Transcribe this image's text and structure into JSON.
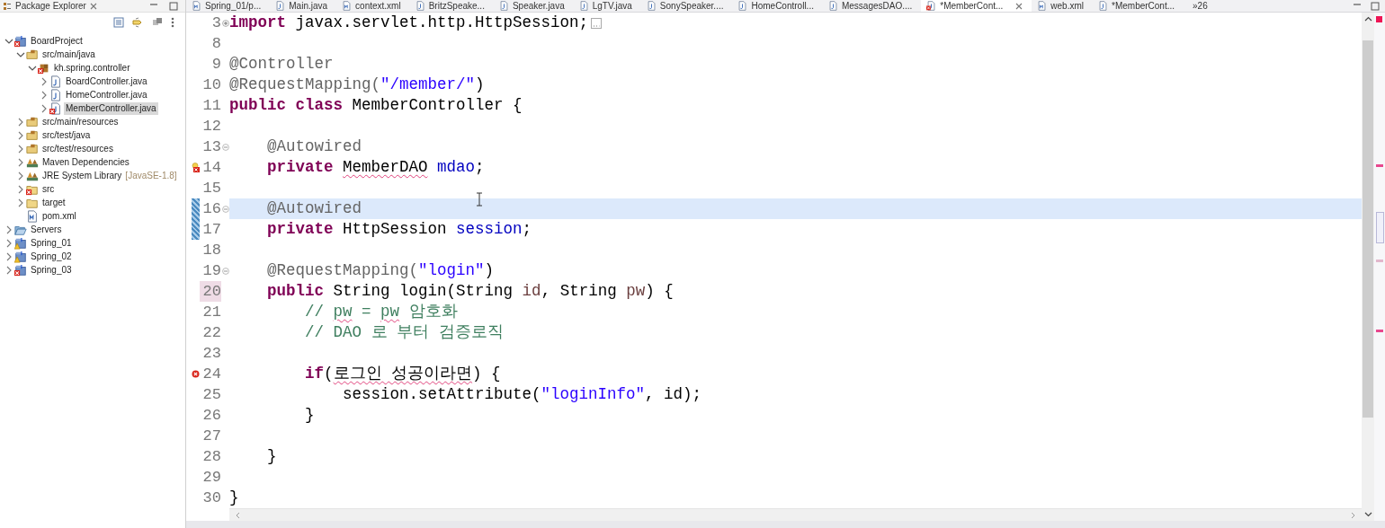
{
  "explorer": {
    "title": "Package Explorer",
    "tree": [
      {
        "label": "BoardProject",
        "kind": "project",
        "error": true,
        "expanded": true,
        "selected": false,
        "children": [
          {
            "label": "src/main/java",
            "kind": "source-folder",
            "expanded": true,
            "selected": false,
            "children": [
              {
                "label": "kh.spring.controller",
                "kind": "package",
                "error": true,
                "expanded": true,
                "selected": false,
                "children": [
                  {
                    "label": "BoardController.java",
                    "kind": "java-file",
                    "expanded": false,
                    "selected": false
                  },
                  {
                    "label": "HomeController.java",
                    "kind": "java-file",
                    "expanded": false,
                    "selected": false
                  },
                  {
                    "label": "MemberController.java",
                    "kind": "java-file",
                    "error": true,
                    "expanded": false,
                    "selected": true
                  }
                ]
              }
            ]
          },
          {
            "label": "src/main/resources",
            "kind": "source-folder",
            "expanded": false,
            "selected": false
          },
          {
            "label": "src/test/java",
            "kind": "source-folder",
            "expanded": false,
            "selected": false
          },
          {
            "label": "src/test/resources",
            "kind": "source-folder",
            "expanded": false,
            "selected": false
          },
          {
            "label": "Maven Dependencies",
            "kind": "library",
            "expanded": false,
            "selected": false
          },
          {
            "label": "JRE System Library",
            "decoration": "[JavaSE-1.8]",
            "kind": "library",
            "expanded": false,
            "selected": false
          },
          {
            "label": "src",
            "kind": "folder",
            "error": true,
            "expanded": false,
            "selected": false
          },
          {
            "label": "target",
            "kind": "folder",
            "expanded": false,
            "selected": false
          },
          {
            "label": "pom.xml",
            "kind": "xml-file",
            "selected": false
          }
        ]
      },
      {
        "label": "Servers",
        "kind": "open-folder",
        "expanded": false,
        "selected": false
      },
      {
        "label": "Spring_01",
        "kind": "project",
        "warning": true,
        "expanded": false,
        "selected": false
      },
      {
        "label": "Spring_02",
        "kind": "project",
        "warning": true,
        "expanded": false,
        "selected": false
      },
      {
        "label": "Spring_03",
        "kind": "project",
        "error": true,
        "expanded": false,
        "selected": false
      }
    ]
  },
  "tabs": [
    {
      "label": "Spring_01/p...",
      "kind": "xml-file",
      "selected": false
    },
    {
      "label": "Main.java",
      "kind": "java-file",
      "selected": false
    },
    {
      "label": "context.xml",
      "kind": "xml-file",
      "selected": false
    },
    {
      "label": "BritzSpeake...",
      "kind": "java-file",
      "selected": false
    },
    {
      "label": "Speaker.java",
      "kind": "java-file",
      "selected": false
    },
    {
      "label": "LgTV.java",
      "kind": "java-file",
      "selected": false
    },
    {
      "label": "SonySpeaker....",
      "kind": "java-file",
      "selected": false
    },
    {
      "label": "HomeControll...",
      "kind": "java-file",
      "selected": false
    },
    {
      "label": "MessagesDAO....",
      "kind": "java-file",
      "selected": false
    },
    {
      "label": "*MemberCont...",
      "kind": "java-file",
      "error": true,
      "selected": true
    },
    {
      "label": "web.xml",
      "kind": "xml-file",
      "selected": false
    },
    {
      "label": "*MemberCont...",
      "kind": "java-file",
      "selected": false
    }
  ],
  "more_tabs": "»26",
  "lines": [
    {
      "number": "3",
      "collapsed": true,
      "current": false,
      "changed": false,
      "highlighted": false,
      "tokens": [
        {
          "text": "import",
          "kind": "keyword"
        },
        {
          "text": " javax.servlet.http.HttpSession;",
          "kind": "plain"
        }
      ]
    },
    {
      "number": "8",
      "current": false,
      "changed": false,
      "highlighted": false
    },
    {
      "number": "9",
      "current": false,
      "changed": false,
      "highlighted": false,
      "tokens": [
        {
          "text": "@Controller",
          "kind": "annotation"
        }
      ]
    },
    {
      "number": "10",
      "current": false,
      "changed": false,
      "highlighted": false,
      "tokens": [
        {
          "text": "@RequestMapping(",
          "kind": "annotation"
        },
        {
          "text": "\"/member/\"",
          "kind": "string"
        },
        {
          "text": ")",
          "kind": "plain"
        }
      ]
    },
    {
      "number": "11",
      "current": false,
      "changed": false,
      "highlighted": false,
      "tokens": [
        {
          "text": "public",
          "kind": "keyword"
        },
        {
          "text": " class",
          "kind": "keyword"
        },
        {
          "text": " MemberController {",
          "kind": "plain"
        }
      ]
    },
    {
      "number": "12",
      "current": false,
      "changed": false,
      "highlighted": false
    },
    {
      "number": "13",
      "collapsed": false,
      "current": false,
      "changed": false,
      "highlighted": false,
      "tokens": [
        {
          "text": "    @Autowired",
          "kind": "annotation"
        }
      ]
    },
    {
      "number": "14",
      "quickfix": true,
      "current": false,
      "changed": false,
      "highlighted": false,
      "tokens": [
        {
          "text": "    private",
          "kind": "keyword"
        },
        {
          "text": " MemberDAO",
          "kind": "plain",
          "error": true
        },
        {
          "text": " mdao",
          "kind": "field"
        },
        {
          "text": ";",
          "kind": "plain"
        }
      ]
    },
    {
      "number": "15",
      "current": false,
      "changed": false,
      "highlighted": false
    },
    {
      "number": "16",
      "collapsed": false,
      "current": true,
      "changed": true,
      "highlighted": false,
      "tokens": [
        {
          "text": "    @Autowired",
          "kind": "annotation"
        }
      ]
    },
    {
      "number": "17",
      "current": false,
      "changed": true,
      "highlighted": false,
      "tokens": [
        {
          "text": "    private",
          "kind": "keyword"
        },
        {
          "text": " HttpSession",
          "kind": "plain"
        },
        {
          "text": " session",
          "kind": "field"
        },
        {
          "text": ";",
          "kind": "plain"
        }
      ]
    },
    {
      "number": "18",
      "current": false,
      "changed": false,
      "highlighted": false
    },
    {
      "number": "19",
      "collapsed": false,
      "current": false,
      "changed": false,
      "highlighted": false,
      "tokens": [
        {
          "text": "    @RequestMapping(",
          "kind": "annotation"
        },
        {
          "text": "\"login\"",
          "kind": "string"
        },
        {
          "text": ")",
          "kind": "plain"
        }
      ]
    },
    {
      "number": "20",
      "current": false,
      "changed": false,
      "highlighted": true,
      "tokens": [
        {
          "text": "    public",
          "kind": "keyword"
        },
        {
          "text": " String login(String",
          "kind": "plain"
        },
        {
          "text": " id",
          "kind": "param"
        },
        {
          "text": ", String",
          "kind": "plain"
        },
        {
          "text": " pw",
          "kind": "param"
        },
        {
          "text": ") {",
          "kind": "plain"
        }
      ]
    },
    {
      "number": "21",
      "current": false,
      "changed": false,
      "highlighted": false,
      "tokens": [
        {
          "text": "        //",
          "kind": "comment"
        },
        {
          "text": " pw",
          "kind": "comment",
          "error": true
        },
        {
          "text": " =",
          "kind": "comment"
        },
        {
          "text": " pw",
          "kind": "comment",
          "error": true
        },
        {
          "text": " 암호화",
          "kind": "comment"
        }
      ]
    },
    {
      "number": "22",
      "current": false,
      "changed": false,
      "highlighted": false,
      "tokens": [
        {
          "text": "        // DAO 로 부터 검증로직",
          "kind": "comment"
        }
      ]
    },
    {
      "number": "23",
      "current": false,
      "changed": false,
      "highlighted": false
    },
    {
      "number": "24",
      "error": true,
      "current": false,
      "changed": false,
      "highlighted": false,
      "tokens": [
        {
          "text": "        if",
          "kind": "keyword"
        },
        {
          "text": "(",
          "kind": "plain"
        },
        {
          "text": "로그인 성공이라면",
          "kind": "plain",
          "error": true
        },
        {
          "text": ") {",
          "kind": "plain"
        }
      ]
    },
    {
      "number": "25",
      "current": false,
      "changed": false,
      "highlighted": false,
      "tokens": [
        {
          "text": "            session.setAttribute(",
          "kind": "plain"
        },
        {
          "text": "\"loginInfo\"",
          "kind": "string"
        },
        {
          "text": ", id);",
          "kind": "plain"
        }
      ]
    },
    {
      "number": "26",
      "current": false,
      "changed": false,
      "highlighted": false,
      "tokens": [
        {
          "text": "        }",
          "kind": "plain"
        }
      ]
    },
    {
      "number": "27",
      "current": false,
      "changed": false,
      "highlighted": false
    },
    {
      "number": "28",
      "current": false,
      "changed": false,
      "highlighted": false,
      "tokens": [
        {
          "text": "    }",
          "kind": "plain"
        }
      ]
    },
    {
      "number": "29",
      "current": false,
      "changed": false,
      "highlighted": false
    },
    {
      "number": "30",
      "current": false,
      "changed": false,
      "highlighted": false,
      "tokens": [
        {
          "text": "}",
          "kind": "plain"
        }
      ]
    }
  ]
}
